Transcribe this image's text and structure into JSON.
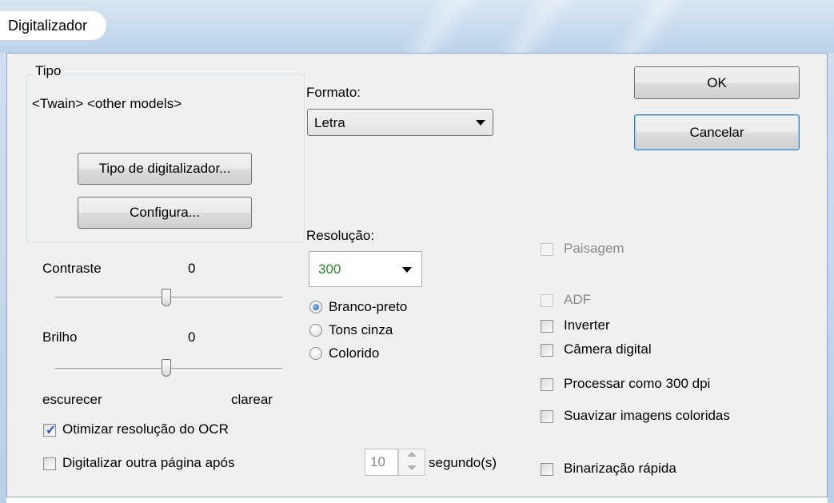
{
  "window": {
    "title": "Digitalizador"
  },
  "type_group": {
    "legend": "Tipo",
    "scanner_name": "<Twain> <other models>",
    "scanner_type_button": "Tipo de digitalizador...",
    "configure_button": "Configura..."
  },
  "format": {
    "label": "Formato:",
    "value": "Letra"
  },
  "resolution": {
    "label": "Resolução:",
    "value": "300",
    "value_color": "#2e8b2e"
  },
  "color_mode": {
    "options": [
      "Branco-preto",
      "Tons cinza",
      "Colorido"
    ],
    "selected": "Branco-preto"
  },
  "contrast": {
    "label": "Contraste",
    "value": "0"
  },
  "brightness": {
    "label": "Brilho",
    "value": "0"
  },
  "brightness_scale": {
    "min_label": "escurecer",
    "max_label": "clarear"
  },
  "options_left": {
    "optimize_ocr": {
      "label": "Otimizar resolução do OCR",
      "checked": true
    },
    "scan_another": {
      "label": "Digitalizar outra página após",
      "checked": false
    }
  },
  "delay": {
    "value": "10",
    "unit": "segundo(s)"
  },
  "buttons": {
    "ok": "OK",
    "cancel": "Cancelar"
  },
  "options_right": {
    "landscape": {
      "label": "Paisagem",
      "checked": false,
      "enabled": false
    },
    "adf": {
      "label": "ADF",
      "checked": false,
      "enabled": false
    },
    "invert": {
      "label": "Inverter",
      "checked": false
    },
    "digital_camera": {
      "label": "Câmera digital",
      "checked": false
    },
    "process_300": {
      "label": "Processar como 300 dpi",
      "checked": false
    },
    "smooth_color": {
      "label": "Suavizar imagens coloridas",
      "checked": false
    },
    "fast_binarize": {
      "label": "Binarização rápida",
      "checked": false
    }
  }
}
